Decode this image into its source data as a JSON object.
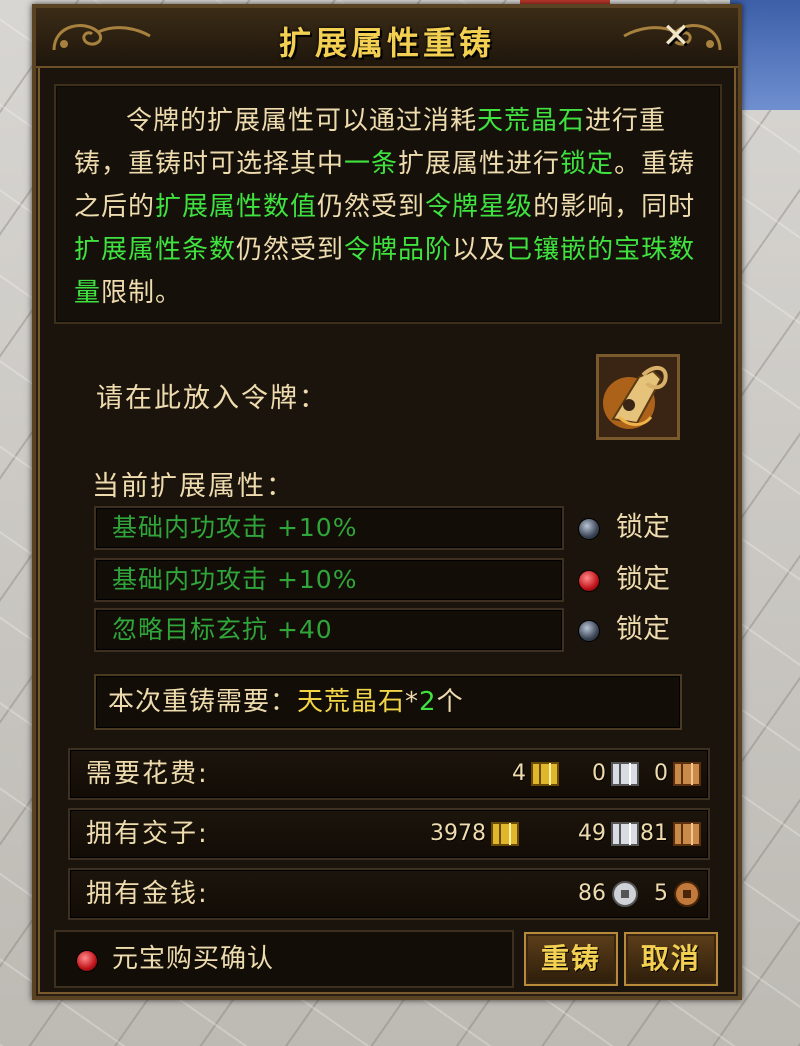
{
  "window": {
    "title": "扩展属性重铸",
    "close_glyph": "✕"
  },
  "description": {
    "segments": [
      {
        "text": "令牌的扩展属性可以通过消耗",
        "color": "normal"
      },
      {
        "text": "天荒晶石",
        "color": "green"
      },
      {
        "text": "进行重铸，重铸时可选择其中",
        "color": "normal"
      },
      {
        "text": "一条",
        "color": "green"
      },
      {
        "text": "扩展属性进行",
        "color": "normal"
      },
      {
        "text": "锁定",
        "color": "green"
      },
      {
        "text": "。重铸之后的",
        "color": "normal"
      },
      {
        "text": "扩展属性数值",
        "color": "green"
      },
      {
        "text": "仍然受到",
        "color": "normal"
      },
      {
        "text": "令牌星级",
        "color": "green"
      },
      {
        "text": "的影响，同时",
        "color": "normal"
      },
      {
        "text": "扩展属性条数",
        "color": "green"
      },
      {
        "text": "仍然受到",
        "color": "normal"
      },
      {
        "text": "令牌品阶",
        "color": "green"
      },
      {
        "text": "以及",
        "color": "normal"
      },
      {
        "text": "已镶嵌的宝珠数量",
        "color": "green"
      },
      {
        "text": "限制。",
        "color": "normal"
      }
    ]
  },
  "token": {
    "label": "请在此放入令牌：",
    "icon": "token-icon"
  },
  "attributes": {
    "label": "当前扩展属性：",
    "lock_label": "锁定",
    "items": [
      {
        "text": "基础内功攻击  +10%",
        "locked": false
      },
      {
        "text": "基础内功攻击  +10%",
        "locked": true
      },
      {
        "text": "忽略目标玄抗  +40",
        "locked": false
      }
    ]
  },
  "requirement": {
    "prefix": "本次重铸需要：",
    "item": "天荒晶石",
    "mult": "*",
    "count": "2",
    "unit": "个"
  },
  "costs": {
    "need": {
      "label": "需要花费:",
      "gold": "4",
      "silver": "0",
      "copper": "0"
    },
    "owned": {
      "label": "拥有交子:",
      "gold": "3978",
      "silver": "49",
      "copper": "81"
    },
    "money": {
      "label": "拥有金钱:",
      "silver": "86",
      "copper": "5"
    }
  },
  "footer": {
    "ingot_confirm": "元宝购买确认",
    "reforge": "重铸",
    "cancel": "取消"
  },
  "colors": {
    "gold": "#f3cf52",
    "green_text": "#3fe23f",
    "attr_green": "#2fa53a",
    "text": "#efdcae",
    "panel_bg": "#1b140d",
    "frame": "#7a5a2c"
  }
}
